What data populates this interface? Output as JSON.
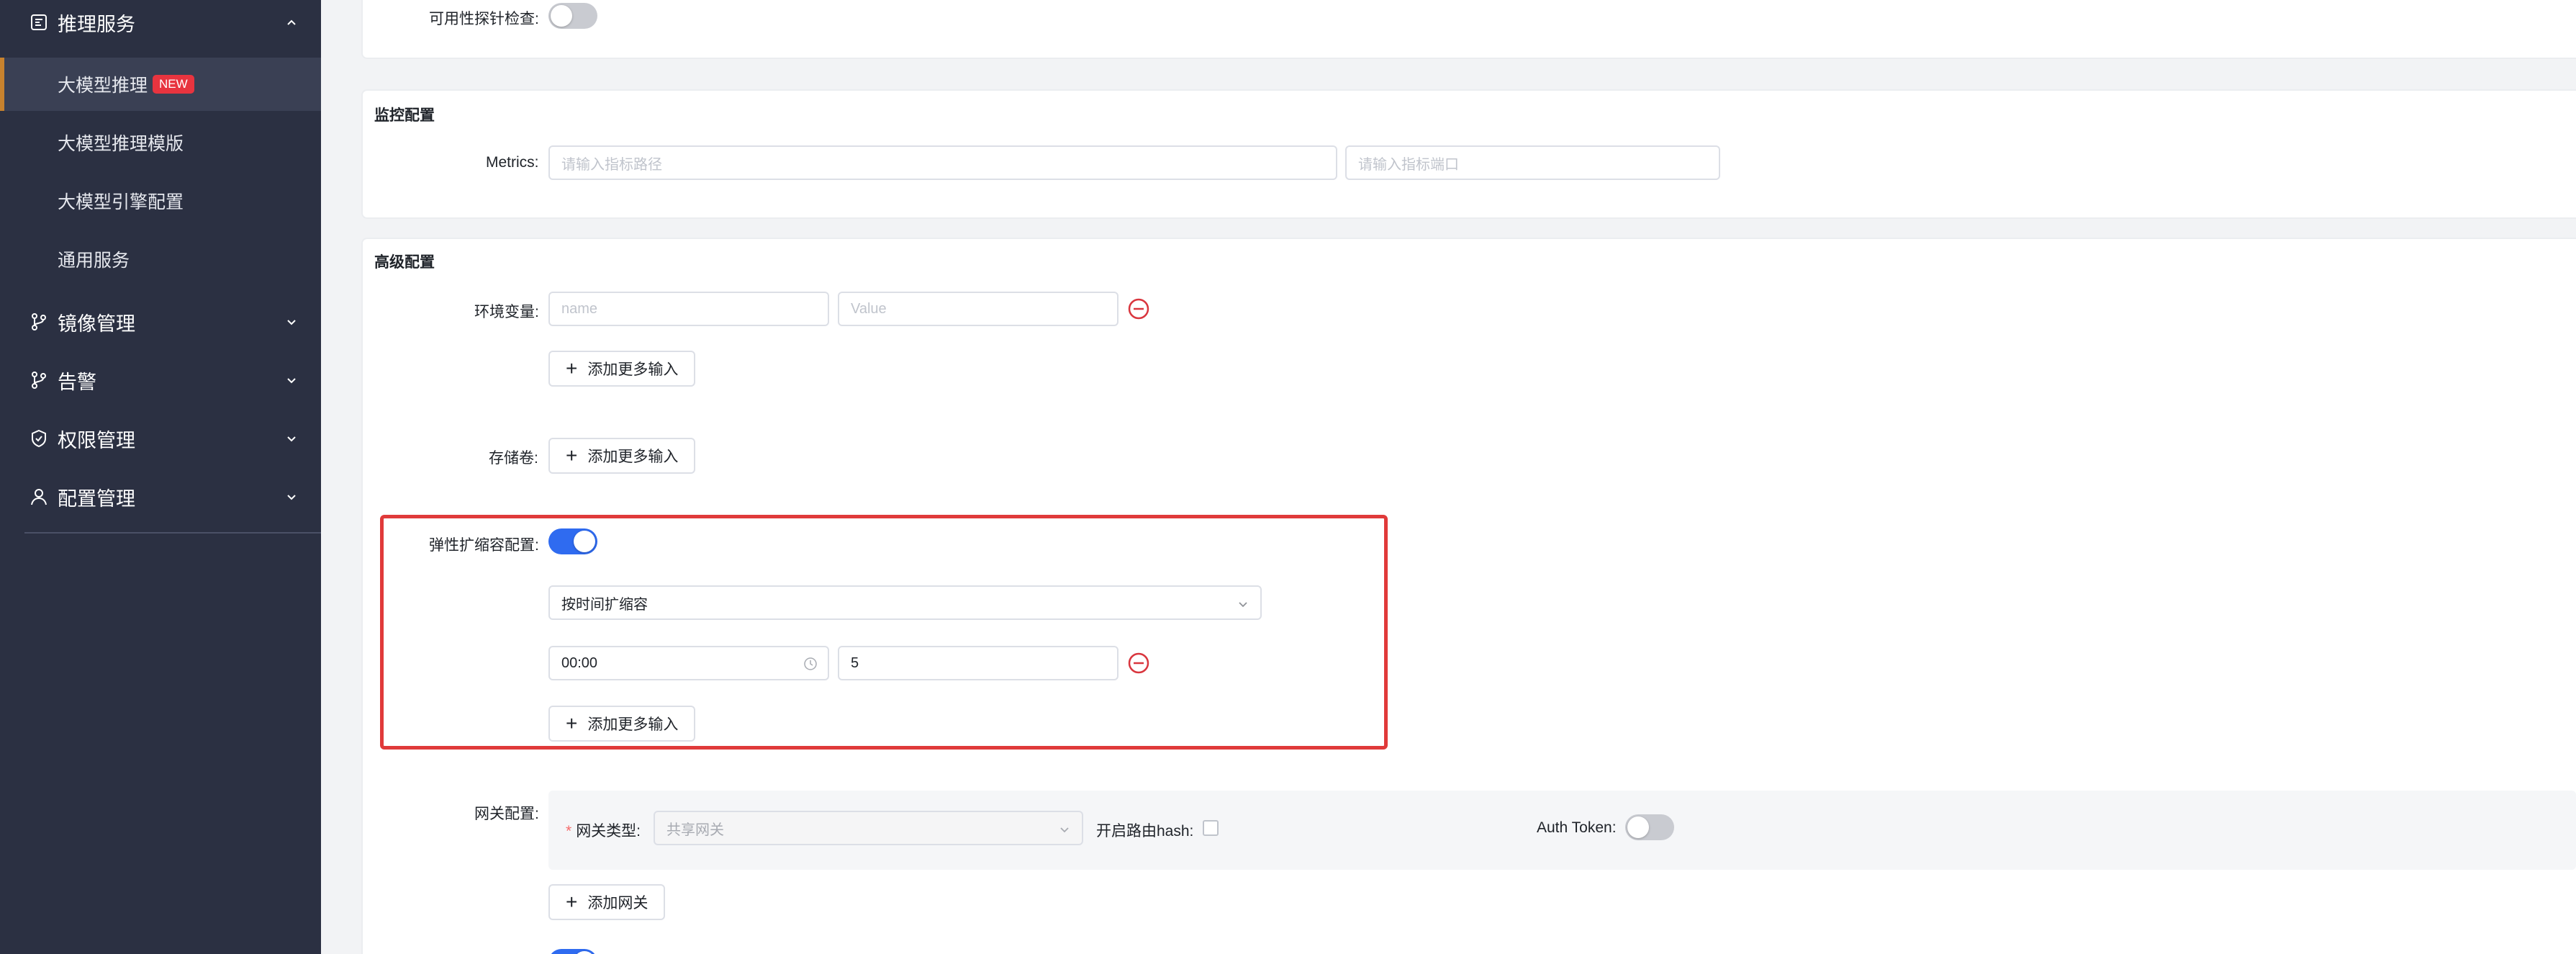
{
  "sidebar": {
    "groups": [
      {
        "label": "推理服务",
        "icon": "inference-icon",
        "expanded": true
      },
      {
        "label": "镜像管理",
        "icon": "branch-icon",
        "expanded": false
      },
      {
        "label": "告警",
        "icon": "branch-icon",
        "expanded": false
      },
      {
        "label": "权限管理",
        "icon": "shield-icon",
        "expanded": false
      },
      {
        "label": "配置管理",
        "icon": "user-icon",
        "expanded": false
      }
    ],
    "items": [
      {
        "label": "大模型推理",
        "badge": "NEW",
        "active": true
      },
      {
        "label": "大模型推理模版"
      },
      {
        "label": "大模型引擎配置"
      },
      {
        "label": "通用服务"
      }
    ]
  },
  "top": {
    "probe_label": "可用性探针检查:",
    "probe_enabled": false
  },
  "monitor": {
    "title": "监控配置",
    "metrics_label": "Metrics:",
    "path_placeholder": "请输入指标路径",
    "port_placeholder": "请输入指标端口"
  },
  "advanced": {
    "title": "高级配置",
    "env_label": "环境变量:",
    "env_name_placeholder": "name",
    "env_value_placeholder": "Value",
    "add_more_label": "添加更多输入",
    "storage_label": "存储卷:",
    "autoscale_label": "弹性扩缩容配置:",
    "autoscale_enabled": true,
    "autoscale_mode": "按时间扩缩容",
    "time_value": "00:00",
    "replica_value": "5",
    "gateway_label": "网关配置:",
    "gateway_type_label": "网关类型:",
    "gateway_type_value": "共享网关",
    "route_hash_label": "开启路由hash:",
    "auth_token_label": "Auth Token:",
    "auth_token_enabled": false,
    "add_gateway_label": "添加网关"
  },
  "colors": {
    "sidebar_bg": "#2b3042",
    "accent": "#2f6bf0",
    "highlight": "#e03a3a",
    "badge": "#e8343f",
    "danger": "#d9363e"
  }
}
